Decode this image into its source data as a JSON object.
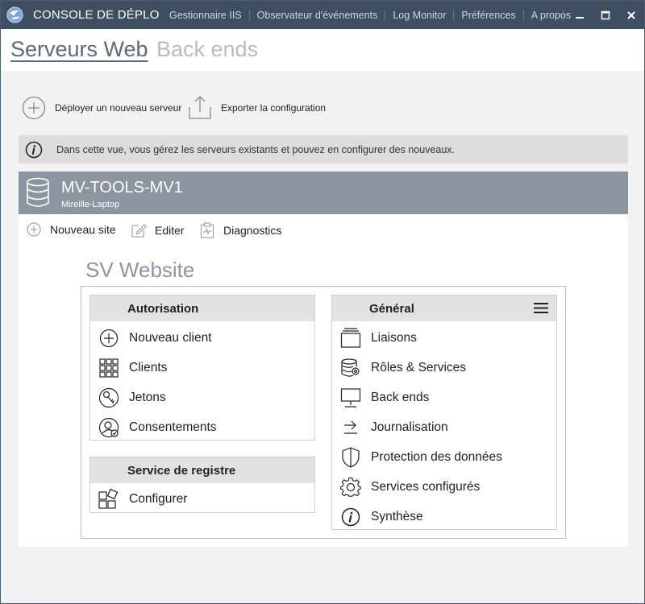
{
  "window": {
    "title": "CONSOLE DE DÉPLOI…",
    "menu": [
      "Gestionnaire IIS",
      "Observateur d'événements",
      "Log Monitor",
      "Préférences",
      "A propos"
    ]
  },
  "tabs": [
    {
      "label": "Serveurs Web",
      "active": true
    },
    {
      "label": "Back ends",
      "active": false
    }
  ],
  "toolbar": {
    "deploy_label": "Déployer un nouveau serveur",
    "export_label": "Exporter la configuration"
  },
  "info": {
    "text": "Dans cette vue, vous gérez les serveurs existants et pouvez en configurer des nouveaux."
  },
  "server": {
    "name": "MV-TOOLS-MV1",
    "host": "Mireille-Laptop",
    "actions": [
      "Nouveau site",
      "Editer",
      "Diagnostics"
    ]
  },
  "site": {
    "title": "SV Website",
    "cards": {
      "autorisation": {
        "title": "Autorisation",
        "items": [
          "Nouveau client",
          "Clients",
          "Jetons",
          "Consentements"
        ]
      },
      "registre": {
        "title": "Service de registre",
        "items": [
          "Configurer"
        ]
      },
      "general": {
        "title": "Général",
        "items": [
          "Liaisons",
          "Rôles & Services",
          "Back ends",
          "Journalisation",
          "Protection des données",
          "Services configurés",
          "Synthèse"
        ]
      }
    }
  },
  "colors": {
    "titlebar": "#3f4e60",
    "server_header": "#8a959f",
    "active_tab": "#5b6b7c",
    "inactive_tab": "#b8bcc0"
  }
}
